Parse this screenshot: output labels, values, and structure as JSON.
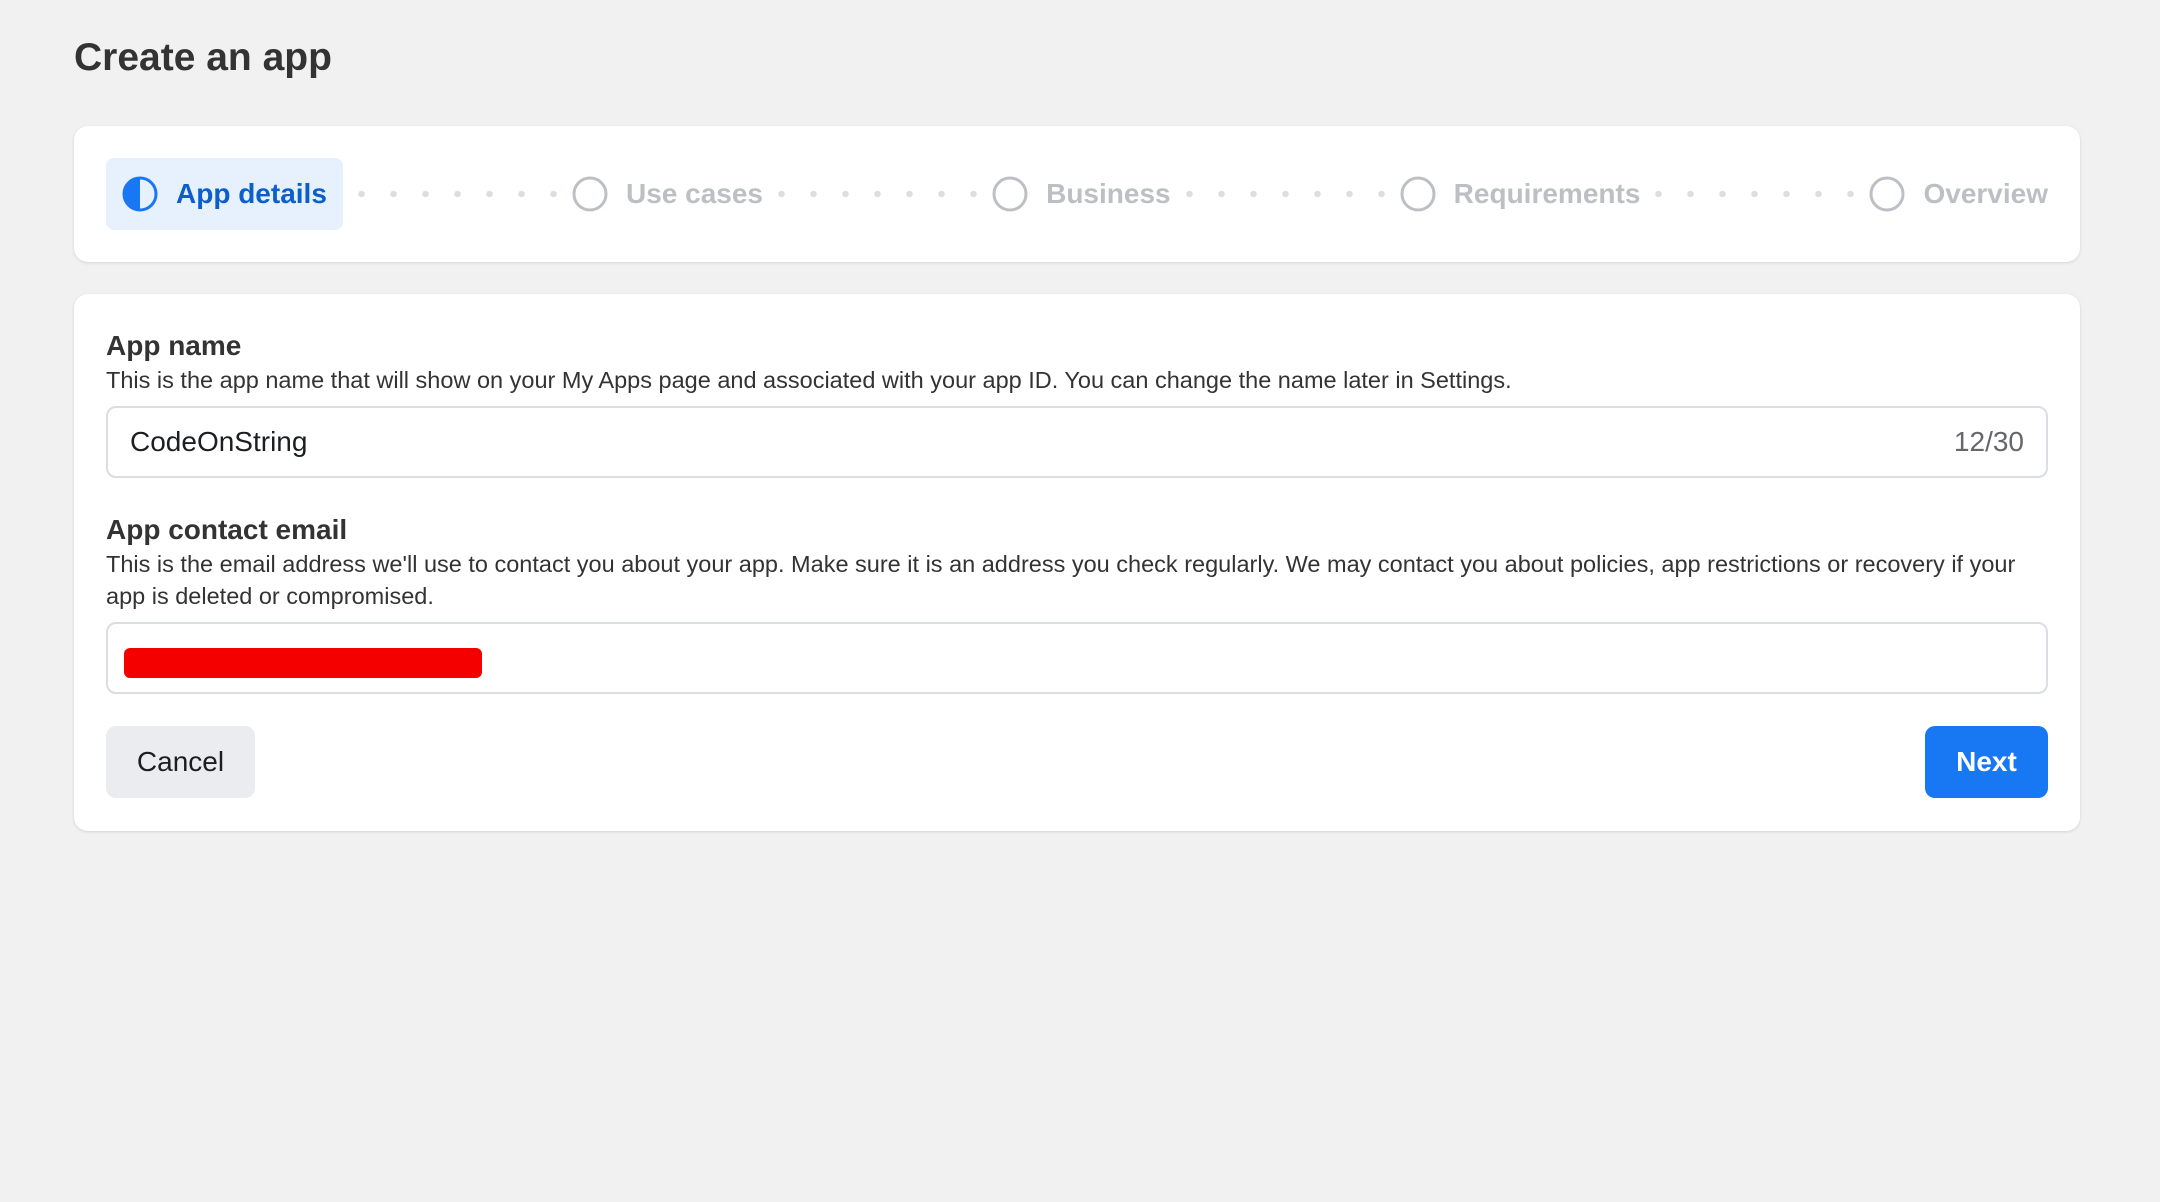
{
  "page": {
    "title": "Create an app"
  },
  "stepper": {
    "steps": [
      {
        "label": "App details",
        "state": "active",
        "icon": "half-filled-circle-icon"
      },
      {
        "label": "Use cases",
        "state": "pending",
        "icon": "empty-circle-icon"
      },
      {
        "label": "Business",
        "state": "pending",
        "icon": "empty-circle-icon"
      },
      {
        "label": "Requirements",
        "state": "pending",
        "icon": "empty-circle-icon"
      },
      {
        "label": "Overview",
        "state": "pending",
        "icon": "empty-circle-icon"
      }
    ]
  },
  "form": {
    "app_name": {
      "label": "App name",
      "help": "This is the app name that will show on your My Apps page and associated with your app ID. You can change the name later in Settings.",
      "value": "CodeOnString",
      "char_count": "12/30"
    },
    "contact_email": {
      "label": "App contact email",
      "help": "This is the email address we'll use to contact you about your app. Make sure it is an address you check regularly. We may contact you about policies, app restrictions or recovery if your app is deleted or compromised.",
      "value": ""
    },
    "cancel_label": "Cancel",
    "next_label": "Next"
  },
  "colors": {
    "page_background": "#f1f1f1",
    "accent": "#1877f2",
    "active_step_text": "#0b5fcc",
    "active_step_background": "#e7f0fd",
    "inactive_step": "#bcc0c4",
    "redaction": "#f40000"
  }
}
